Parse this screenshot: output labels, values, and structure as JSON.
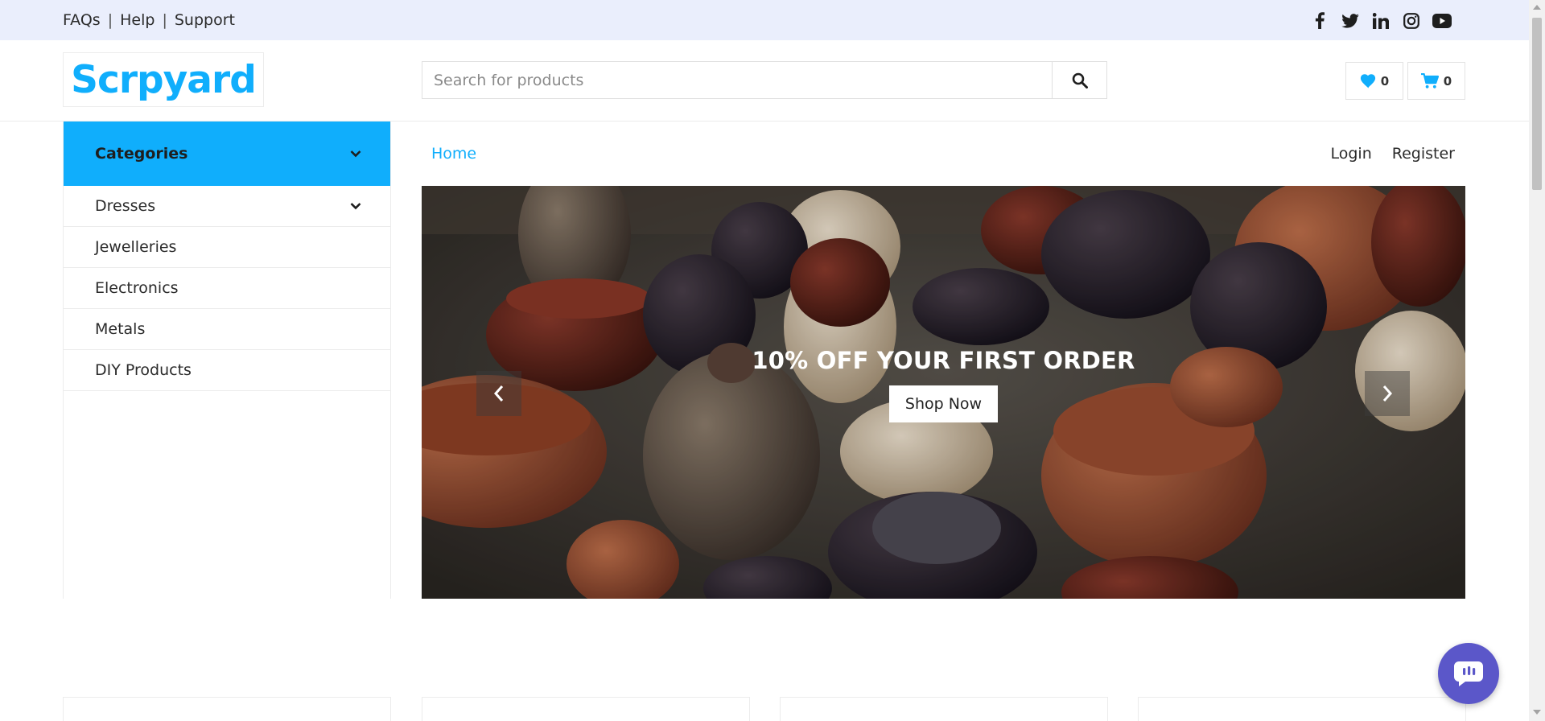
{
  "topbar": {
    "links": [
      "FAQs",
      "Help",
      "Support"
    ],
    "separator": "|",
    "social_icons": [
      "facebook-icon",
      "twitter-icon",
      "linkedin-icon",
      "instagram-icon",
      "youtube-icon"
    ]
  },
  "header": {
    "logo": "Scrpyard",
    "search_placeholder": "Search for products",
    "wishlist_count": "0",
    "cart_count": "0"
  },
  "sidebar": {
    "title": "Categories",
    "items": [
      {
        "label": "Dresses",
        "has_dropdown": true
      },
      {
        "label": "Jewelleries",
        "has_dropdown": false
      },
      {
        "label": "Electronics",
        "has_dropdown": false
      },
      {
        "label": "Metals",
        "has_dropdown": false
      },
      {
        "label": "DIY Products",
        "has_dropdown": false
      }
    ]
  },
  "nav": {
    "home": "Home",
    "login": "Login",
    "register": "Register"
  },
  "hero": {
    "title": "10% OFF YOUR FIRST ORDER",
    "button": "Shop Now"
  },
  "colors": {
    "accent": "#10aefc",
    "topbar_bg": "#eaeefc",
    "chat": "#5b57c9"
  }
}
